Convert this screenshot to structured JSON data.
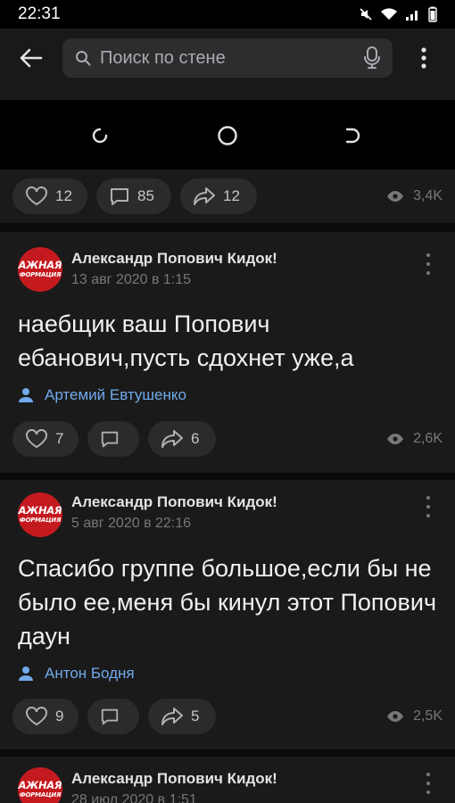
{
  "status_bar": {
    "time": "22:31"
  },
  "search": {
    "placeholder": "Поиск по стене"
  },
  "top_post_actions": {
    "likes": "12",
    "comments": "85",
    "shares": "12",
    "views": "3,4K"
  },
  "posts": [
    {
      "avatar_text_1": "АЖНАЯ",
      "avatar_text_2": "ФОРМАЦИЯ",
      "author": "Александр Попович Кидок!",
      "date": "13 авг 2020 в 1:15",
      "text": "наебщик ваш Попович ебанович,пусть сдохнет уже,а",
      "signer": "Артемий Евтушенко",
      "likes": "7",
      "comments": "",
      "shares": "6",
      "views": "2,6K"
    },
    {
      "avatar_text_1": "АЖНАЯ",
      "avatar_text_2": "ФОРМАЦИЯ",
      "author": "Александр Попович Кидок!",
      "date": "5 авг 2020 в 22:16",
      "text": "Спасибо группе большое,если бы не было ее,меня бы кинул этот Попович даун",
      "signer": "Антон Бодня",
      "likes": "9",
      "comments": "",
      "shares": "5",
      "views": "2,5K"
    },
    {
      "avatar_text_1": "АЖНАЯ",
      "avatar_text_2": "ФОРМАЦИЯ",
      "author": "Александр Попович Кидок!",
      "date": "28 июл 2020 в 1:51"
    }
  ],
  "colors": {
    "accent": "#71aaeb",
    "card_bg": "#1a1a1a",
    "pill_bg": "#2b2b2c",
    "avatar_red": "#c41a1f"
  }
}
